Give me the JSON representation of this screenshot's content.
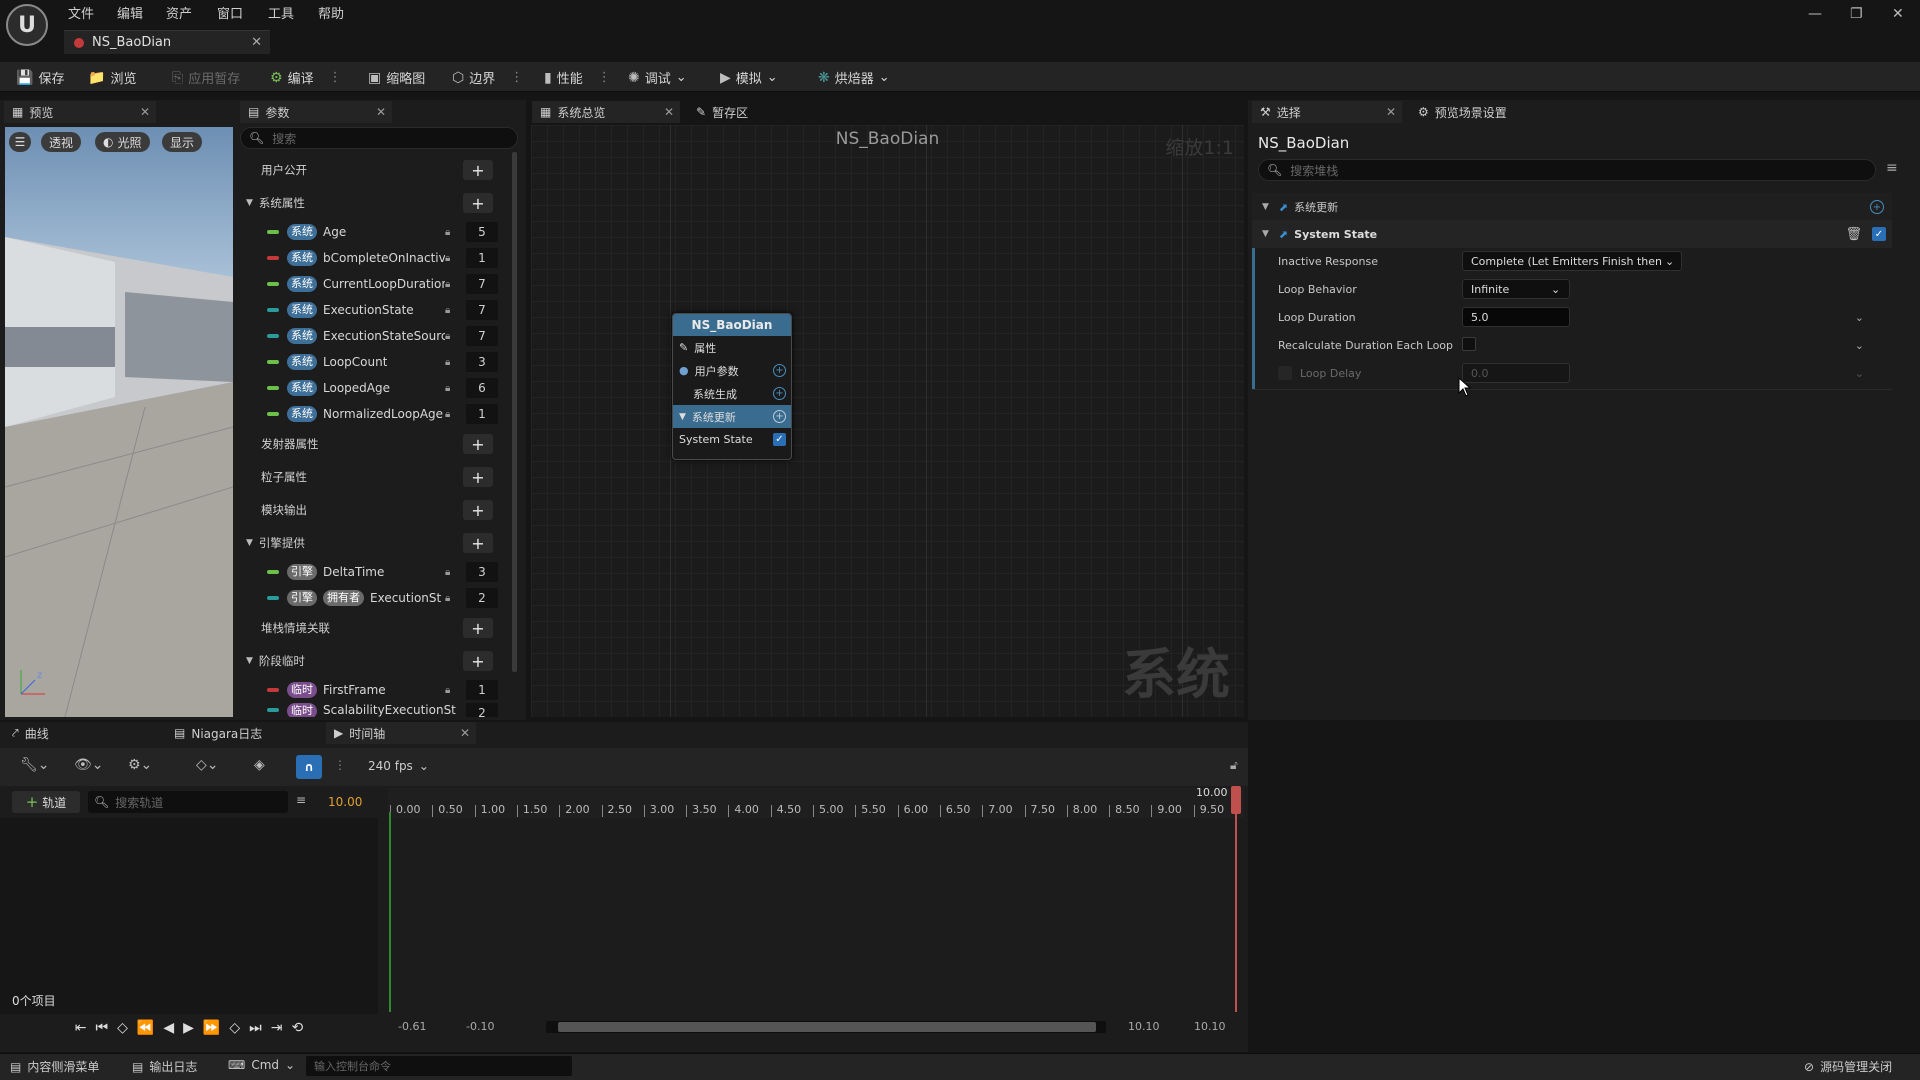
{
  "menu": [
    "文件",
    "编辑",
    "资产",
    "窗口",
    "工具",
    "帮助"
  ],
  "doc_tab": "NS_BaoDian",
  "toolbar": {
    "save": "保存",
    "browse": "浏览",
    "apply": "应用暂存",
    "compile": "编译",
    "thumbnail": "缩略图",
    "bounds": "边界",
    "perf": "性能",
    "debug": "调试",
    "simulate": "模拟",
    "bake": "烘焙器"
  },
  "preview": {
    "tab": "预览",
    "perspective": "透视",
    "lit": "光照",
    "show": "显示"
  },
  "params": {
    "tab": "参数",
    "search_placeholder": "搜索",
    "user_exposed": "用户公开",
    "system_attributes": "系统属性",
    "system_items": [
      {
        "tag": "系统",
        "name": "Age",
        "value": "5",
        "color": "#6cc04a"
      },
      {
        "tag": "系统",
        "name": "bCompleteOnInactive",
        "value": "1",
        "color": "#c43a3a"
      },
      {
        "tag": "系统",
        "name": "CurrentLoopDuration",
        "value": "7",
        "color": "#6cc04a"
      },
      {
        "tag": "系统",
        "name": "ExecutionState",
        "value": "7",
        "color": "#2a9a9a"
      },
      {
        "tag": "系统",
        "name": "ExecutionStateSourc",
        "value": "7",
        "color": "#2a9a9a"
      },
      {
        "tag": "系统",
        "name": "LoopCount",
        "value": "3",
        "color": "#6cc04a"
      },
      {
        "tag": "系统",
        "name": "LoopedAge",
        "value": "6",
        "color": "#6cc04a"
      },
      {
        "tag": "系统",
        "name": "NormalizedLoopAge",
        "value": "1",
        "color": "#6cc04a"
      }
    ],
    "emitter_attributes": "发射器属性",
    "particle_attributes": "粒子属性",
    "module_output": "模块输出",
    "engine_provided": "引擎提供",
    "engine_items": [
      {
        "tags": [
          "引擎"
        ],
        "name": "DeltaTime",
        "value": "3",
        "color": "#6cc04a"
      },
      {
        "tags": [
          "引擎",
          "拥有者"
        ],
        "name": "ExecutionSt",
        "value": "2",
        "color": "#2a9a9a"
      }
    ],
    "stack_context": "堆栈情境关联",
    "stage_transient": "阶段临时",
    "transient_items": [
      {
        "tag": "临时",
        "name": "FirstFrame",
        "value": "1",
        "color": "#c43a3a"
      },
      {
        "tag": "临时",
        "name": "ScalabilityExecutionSt",
        "value": "2",
        "color": "#2a9a9a"
      }
    ]
  },
  "graph": {
    "tab_overview": "系统总览",
    "tab_scratch": "暂存区",
    "title": "NS_BaoDian",
    "zoom": "缩放1:1",
    "watermark": "系统",
    "node": {
      "title": "NS_BaoDian",
      "attributes": "属性",
      "user_params": "用户参数",
      "system_spawn": "系统生成",
      "system_update": "系统更新",
      "system_state": "System State"
    }
  },
  "details": {
    "tab_select": "选择",
    "tab_preview_settings": "预览场景设置",
    "object_name": "NS_BaoDian",
    "search_placeholder": "搜索堆栈",
    "section_update": "系统更新",
    "section_state": "System State",
    "rows": {
      "inactive_response": {
        "label": "Inactive Response",
        "value": "Complete (Let Emitters Finish then I"
      },
      "loop_behavior": {
        "label": "Loop Behavior",
        "value": "Infinite"
      },
      "loop_duration": {
        "label": "Loop Duration",
        "value": "5.0"
      },
      "recalc": {
        "label": "Recalculate Duration Each Loop"
      },
      "loop_delay": {
        "label": "Loop Delay",
        "value": "0.0"
      }
    }
  },
  "bottom_tabs": {
    "curves": "曲线",
    "niagara_log": "Niagara日志",
    "timeline": "时间轴"
  },
  "timeline": {
    "fps": "240 fps",
    "add_track": "轨道",
    "search_placeholder": "搜索轨道",
    "current_time": "10.00",
    "end_time": "10.00",
    "items_count": "0个项目",
    "ticks": [
      "0.00",
      "0.50",
      "1.00",
      "1.50",
      "2.00",
      "2.50",
      "3.00",
      "3.50",
      "4.00",
      "4.50",
      "5.00",
      "5.50",
      "6.00",
      "6.50",
      "7.00",
      "7.50",
      "8.00",
      "8.50",
      "9.00",
      "9.50"
    ],
    "view_start": "-0.61",
    "play_start": "-0.10",
    "play_end": "10.10",
    "view_end": "10.10"
  },
  "status": {
    "content_drawer": "内容侧滑菜单",
    "output_log": "输出日志",
    "cmd": "Cmd",
    "console_placeholder": "输入控制台命令",
    "source_control": "源码管理关闭"
  }
}
